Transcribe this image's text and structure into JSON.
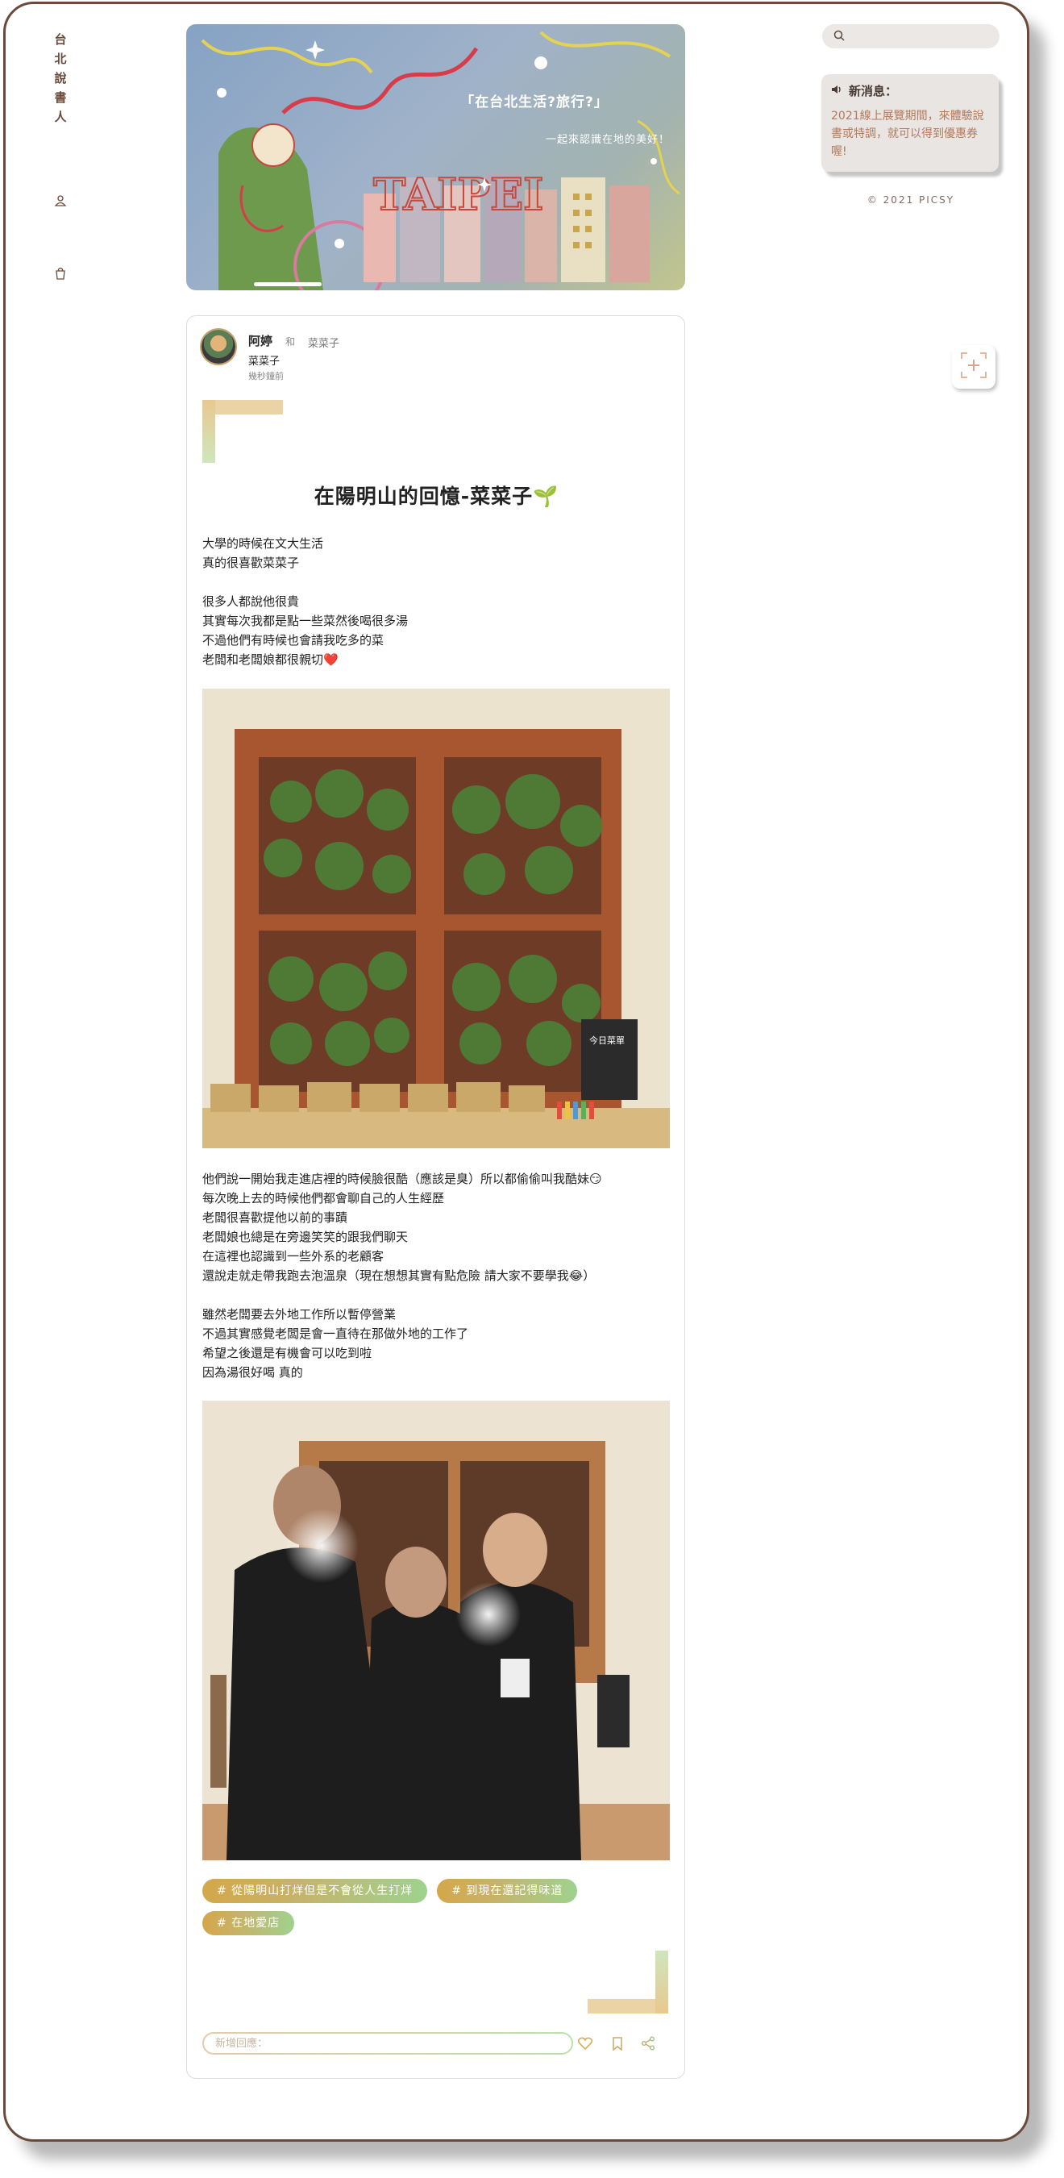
{
  "sidebar": {
    "brand_chars": [
      "台",
      "北",
      "說",
      "書",
      "人"
    ],
    "icons": [
      "user-icon",
      "shopping-bag-icon"
    ]
  },
  "banner": {
    "title": "「在台北生活?旅行?」",
    "subtitle": "一起來認識在地的美好！",
    "art_text": "TAIPEI"
  },
  "search": {
    "placeholder": ""
  },
  "news": {
    "heading": "新消息：",
    "body": "2021線上展覽期間，來體驗說書或特調，就可以得到優惠券喔!"
  },
  "copyright": "© 2021 PICSY",
  "post": {
    "author": "阿婷",
    "with_text": "和",
    "place_tag": "菜菜子",
    "location": "菜菜子",
    "time": "幾秒鐘前",
    "title": "在陽明山的回憶-菜菜子🌱",
    "paragraphs": [
      "大學的時候在文大生活\n真的很喜歡菜菜子",
      "很多人都說他很貴\n其實每次我都是點一些菜然後喝很多湯\n不過他們有時候也會請我吃多的菜\n老闆和老闆娘都很親切❤️",
      "他們說一開始我走進店裡的時候臉很酷（應該是臭）所以都偷偷叫我酷妹😏\n每次晚上去的時候他們都會聊自己的人生經歷\n老闆很喜歡提他以前的事蹟\n老闆娘也總是在旁邊笑笑的跟我們聊天\n在這裡也認識到一些外系的老顧客\n還說走就走帶我跑去泡溫泉（現在想想其實有點危險 請大家不要學我😂）",
      "雖然老闆要去外地工作所以暫停營業\n不過其實感覺老闆是會一直待在那做外地的工作了\n希望之後還是有機會可以吃到啦\n因為湯很好喝 真的"
    ],
    "photo1_sign": "今日菜單",
    "tags": [
      "# 從陽明山打烊但是不會從人生打烊",
      "# 到現在還記得味道",
      "# 在地愛店"
    ],
    "reply_placeholder": "新增回應："
  },
  "colors": {
    "frame": "#6b4a3c",
    "tag_gradient_start": "#d4a74a",
    "tag_gradient_end": "#9ed28e",
    "news_text": "#b3795a"
  }
}
